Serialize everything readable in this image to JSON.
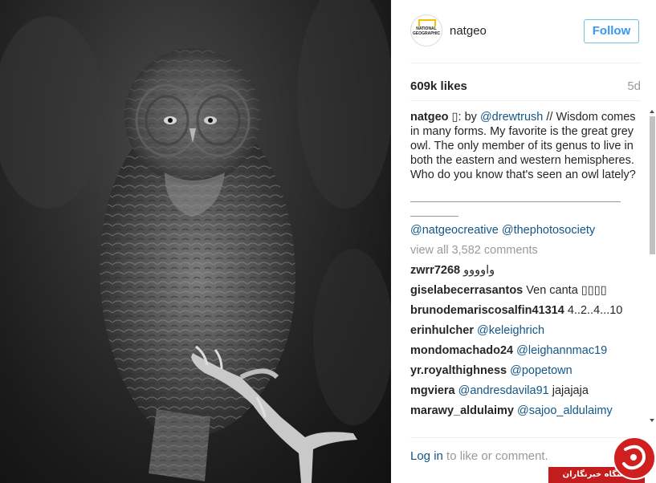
{
  "photo": {
    "subject": "great grey owl"
  },
  "header": {
    "avatar_text": "NATIONAL GEOGRAPHIC",
    "username": "natgeo",
    "follow_label": "Follow"
  },
  "stats": {
    "likes": "609k likes",
    "time_ago": "5d"
  },
  "caption": {
    "user": "natgeo",
    "prefix": " \u0000: by ",
    "mention": "@drewtrush",
    "text": " // Wisdom comes in many forms. My favorite is the great grey owl. The only member of its genus to live in both the eastern and western hemispheres. Who do you know that's seen an owl lately?",
    "tag1": "@natgeocreative",
    "tag2": "@thephotosociety"
  },
  "view_all": "view all 3,582 comments",
  "comments": [
    {
      "user": "zwrr7268",
      "text": " واوووو",
      "text_is_link": false
    },
    {
      "user": "giselabecerrasantos",
      "text": " Ven canta ▯▯▯▯",
      "text_is_link": false
    },
    {
      "user": "brunodemariscosalfin41314",
      "text": " 4..2..4...10",
      "text_is_link": false
    },
    {
      "user": "erinhulcher",
      "text": " @keleighrich",
      "text_is_link": true
    },
    {
      "user": "mondomachado24",
      "text": " @leighannmac19",
      "text_is_link": true
    },
    {
      "user": "yr.royalthighness",
      "text": " @popetown",
      "text_is_link": true
    },
    {
      "user": "mgviera",
      "text": " @andresdavila91",
      "text_is_link": true,
      "extra": " jajajaja"
    },
    {
      "user": "marawy_aldulaimy",
      "text": " @sajoo_aldulaimy",
      "text_is_link": true
    }
  ],
  "login": {
    "link": "Log in",
    "rest": " to like or comment."
  },
  "watermark": {
    "text": "باشگاه خبرنگاران"
  },
  "colors": {
    "link": "#125688",
    "follow": "#3897f0",
    "muted": "#999999",
    "watermark": "#c41d1d"
  }
}
